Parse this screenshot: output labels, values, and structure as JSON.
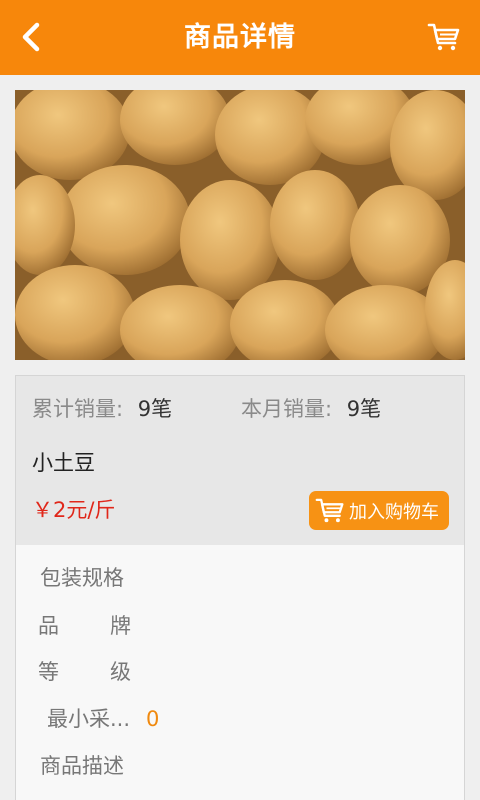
{
  "header": {
    "title": "商品详情",
    "back_icon": "chevron-left-icon",
    "cart_icon": "shopping-cart-icon",
    "bg_color": "#f7870b"
  },
  "product": {
    "image_subject": "potatoes",
    "total_sales_label": "累计销量:",
    "total_sales_value": "9笔",
    "monthly_sales_label": "本月销量:",
    "monthly_sales_value": "9笔",
    "name": "小土豆",
    "price": "￥2元/斤",
    "add_to_cart_label": "加入购物车",
    "price_color": "#e0271a"
  },
  "specs": {
    "packaging_label": "包装规格",
    "brand_label_1": "品",
    "brand_label_2": "牌",
    "grade_label_1": "等",
    "grade_label_2": "级",
    "min_purchase_label": "最小采...",
    "min_purchase_value": "0",
    "description_label": "商品描述"
  }
}
